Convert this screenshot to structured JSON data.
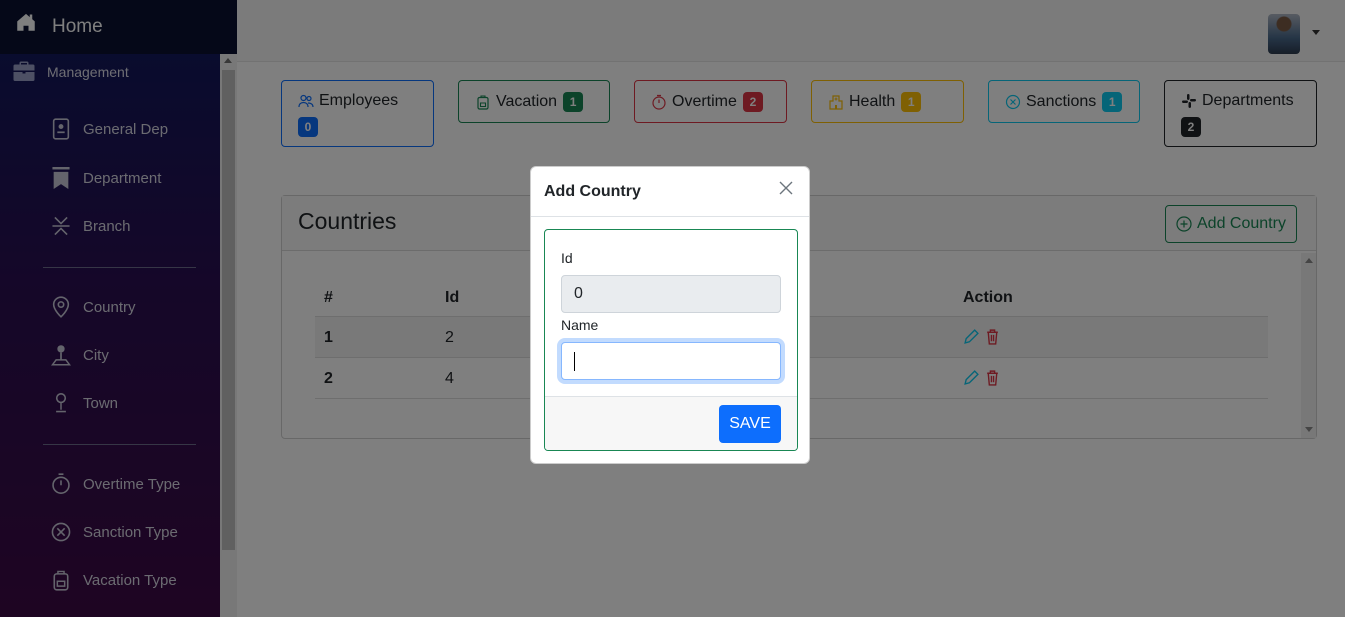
{
  "sidebar": {
    "home_label": "Home",
    "management_label": "Management",
    "items_group1": [
      {
        "label": "General Dep",
        "icon": "id-card-icon"
      },
      {
        "label": "Department",
        "icon": "bookmark-icon"
      },
      {
        "label": "Branch",
        "icon": "branch-icon"
      }
    ],
    "items_group2": [
      {
        "label": "Country",
        "icon": "location-pin-icon"
      },
      {
        "label": "City",
        "icon": "map-pin-icon"
      },
      {
        "label": "Town",
        "icon": "pin-icon"
      }
    ],
    "items_group3": [
      {
        "label": "Overtime Type",
        "icon": "stopwatch-icon"
      },
      {
        "label": "Sanction Type",
        "icon": "x-circle-icon"
      },
      {
        "label": "Vacation Type",
        "icon": "backpack-icon"
      }
    ]
  },
  "stats": [
    {
      "label": "Employees",
      "count": "0",
      "color": "#0d6efd",
      "icon": "people-icon"
    },
    {
      "label": "Vacation",
      "count": "1",
      "color": "#198754",
      "icon": "backpack-icon"
    },
    {
      "label": "Overtime",
      "count": "2",
      "color": "#dc3545",
      "icon": "stopwatch-icon"
    },
    {
      "label": "Health",
      "count": "1",
      "color": "#ffc107",
      "icon": "hospital-icon"
    },
    {
      "label": "Sanctions",
      "count": "1",
      "color": "#0dcaf0",
      "icon": "x-circle-icon"
    },
    {
      "label": "Departments",
      "count": "2",
      "color": "#212529",
      "icon": "slack-icon"
    }
  ],
  "countries": {
    "title": "Countries",
    "add_button_label": "Add Country",
    "columns": [
      "#",
      "Id",
      "Action"
    ],
    "rows": [
      {
        "num": "1",
        "id": "2"
      },
      {
        "num": "2",
        "id": "4"
      }
    ]
  },
  "modal": {
    "title": "Add Country",
    "id_label": "Id",
    "id_value": "0",
    "name_label": "Name",
    "name_value": "",
    "save_label": "SAVE"
  }
}
